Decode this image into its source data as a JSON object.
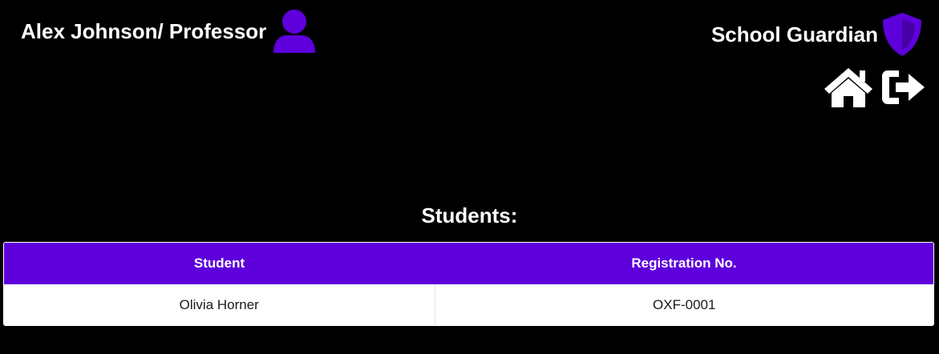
{
  "header": {
    "user_label": "Alex Johnson/ Professor",
    "user_icon": "user-icon",
    "brand_name": "School Guardian",
    "brand_icon": "shield-icon",
    "nav": [
      {
        "icon": "home-icon",
        "label": "Home"
      },
      {
        "icon": "sign-out-icon",
        "label": "Sign out"
      }
    ]
  },
  "colors": {
    "accent": "#5e00dc",
    "background": "#000000",
    "text": "#ffffff"
  },
  "students_section": {
    "title": "Students:",
    "columns": [
      "Student",
      "Registration No."
    ],
    "rows": [
      {
        "student": "Olivia Horner",
        "registration": "OXF-0001"
      }
    ]
  }
}
